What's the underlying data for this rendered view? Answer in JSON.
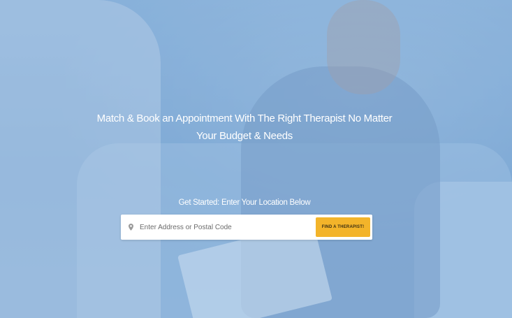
{
  "hero": {
    "headline_line1": "Match & Book an Appointment With The Right Therapist No Matter",
    "headline_line2": "Your Budget & Needs",
    "subheadline": "Get Started: Enter Your Location Below"
  },
  "search": {
    "icon": "map-pin-icon",
    "placeholder": "Enter Address or Postal Code",
    "value": "",
    "button_label": "FIND A THERAPIST!"
  },
  "colors": {
    "overlay": "#7ea9d4",
    "button": "#f3b42a",
    "text": "#ffffff"
  }
}
